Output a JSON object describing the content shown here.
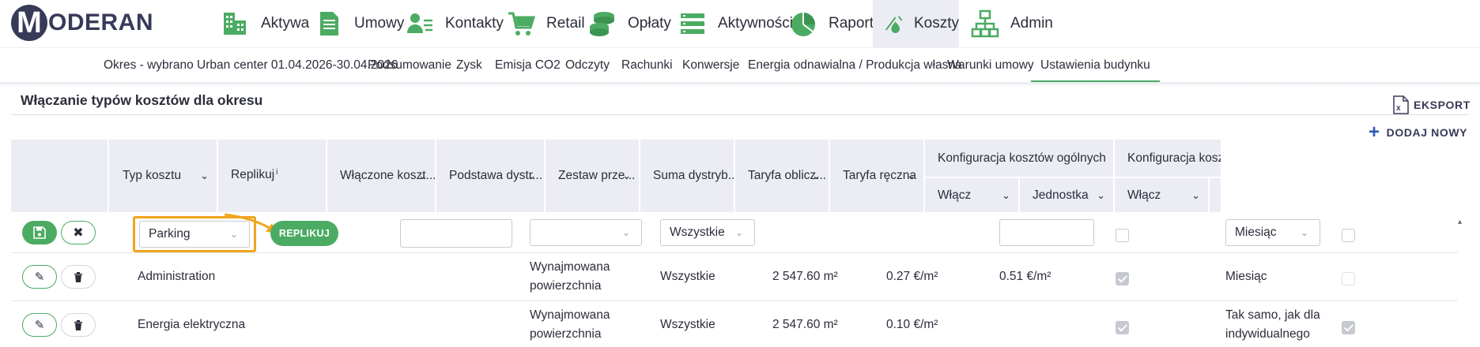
{
  "brand": {
    "logo_letter": "M",
    "logo_text": "ODERAN"
  },
  "nav": [
    {
      "label": "Aktywa",
      "icon": "buildings-icon"
    },
    {
      "label": "Umowy",
      "icon": "document-icon"
    },
    {
      "label": "Kontakty",
      "icon": "contacts-icon"
    },
    {
      "label": "Retail",
      "icon": "cart-icon"
    },
    {
      "label": "Opłaty",
      "icon": "coins-icon"
    },
    {
      "label": "Aktywności",
      "icon": "list-icon"
    },
    {
      "label": "Raporty",
      "icon": "pie-chart-icon"
    },
    {
      "label": "Koszty",
      "icon": "costs-icon",
      "active": true
    },
    {
      "label": "Admin",
      "icon": "hierarchy-icon"
    }
  ],
  "subnav": [
    {
      "label": "Okres - wybrano Urban center 01.04.2026-30.04.2026"
    },
    {
      "label": "Podsumowanie"
    },
    {
      "label": "Zysk"
    },
    {
      "label": "Emisja CO2"
    },
    {
      "label": "Odczyty"
    },
    {
      "label": "Rachunki"
    },
    {
      "label": "Konwersje"
    },
    {
      "label": "Energia odnawialna / Produkcja własna"
    },
    {
      "label": "Warunki umowy"
    },
    {
      "label": "Ustawienia budynku",
      "active": true
    }
  ],
  "section": {
    "title": "Włączanie typów kosztów dla okresu",
    "export_label": "EKSPORT",
    "add_new_label": "DODAJ NOWY"
  },
  "table": {
    "headers": {
      "typ_kosztu": "Typ kosztu",
      "replikuj": "Replikuj",
      "replikuj_sup": "i",
      "wlaczone": "Włączone koszt...",
      "podstawa": "Podstawa dystr...",
      "zestaw": "Zestaw prze...",
      "suma": "Suma dystryb...",
      "taryfa_oblicz": "Taryfa oblicz...",
      "taryfa_reczna": "Taryfa ręczna",
      "konfig_ogolne": "Konfiguracja kosztów ogólnych",
      "konfig_other": "Konfiguracja kosztów",
      "wlacz": "Włącz",
      "jednostka": "Jednostka",
      "wlacz2": "Włącz"
    },
    "edit_row": {
      "typ_kosztu": "Parking",
      "replikuj_button": "REPLIKUJ",
      "wlaczone": "",
      "podstawa": "",
      "zestaw": "Wszystkie",
      "taryfa_reczna": "",
      "jednostka": "Miesiąc"
    },
    "rows": [
      {
        "typ_kosztu": "Administration",
        "podstawa_1": "Wynajmowana",
        "podstawa_2": "powierzchnia",
        "zestaw": "Wszystkie",
        "suma": "2 547.60 m²",
        "taryfa_oblicz": "0.27 €/m²",
        "taryfa_reczna": "0.51 €/m²",
        "wlacz_checked": true,
        "jednostka_1": "Miesiąc",
        "jednostka_2": "",
        "wlacz2_checked": false
      },
      {
        "typ_kosztu": "Energia elektryczna",
        "podstawa_1": "Wynajmowana",
        "podstawa_2": "powierzchnia",
        "zestaw": "Wszystkie",
        "suma": "2 547.60 m²",
        "taryfa_oblicz": "0.10 €/m²",
        "taryfa_reczna": "",
        "wlacz_checked": true,
        "jednostka_1": "Tak samo, jak dla",
        "jednostka_2": "indywidualnego",
        "wlacz2_checked": true
      }
    ]
  },
  "colors": {
    "accent_green": "#4cab63",
    "nav_dark": "#383a59",
    "highlight": "#f0a51f",
    "header_bg": "#ecedf4"
  }
}
